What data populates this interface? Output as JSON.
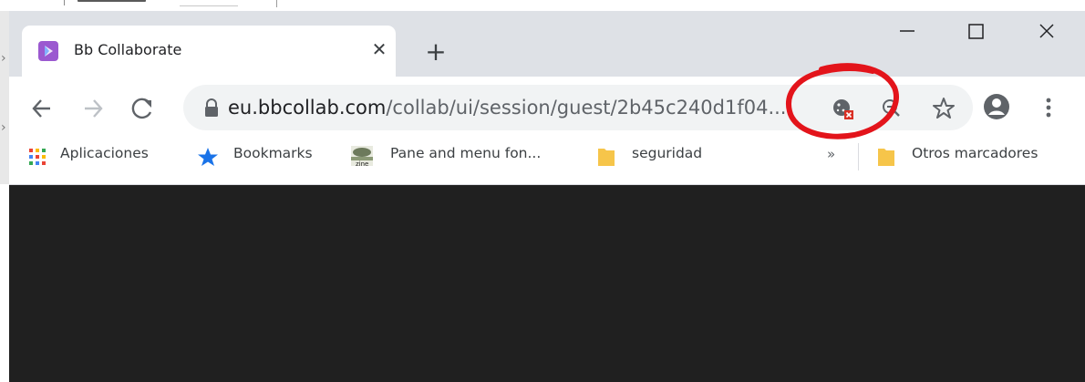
{
  "tab": {
    "title": "Bb Collaborate",
    "favicon": "bb-collaborate-icon"
  },
  "window_controls": {
    "minimize": "minimize-icon",
    "maximize": "maximize-icon",
    "close": "close-icon"
  },
  "address_bar": {
    "domain": "eu.bbcollab.com",
    "path": "/collab/ui/session/guest/2b45c240d1f04..."
  },
  "bookmarks": [
    {
      "label": "Aplicaciones",
      "icon": "apps-grid-icon"
    },
    {
      "label": "Bookmarks",
      "icon": "star-icon"
    },
    {
      "label": "Pane and menu fon...",
      "icon": "zine-icon"
    },
    {
      "label": "seguridad",
      "icon": "folder-icon"
    }
  ],
  "other_bookmarks": {
    "label": "Otros marcadores",
    "icon": "folder-icon"
  },
  "colors": {
    "titlebar": "#dee1e6",
    "omnibox": "#f1f3f4",
    "content": "#202020",
    "annotation": "#e3141b",
    "favicon": "#9b59d0"
  }
}
